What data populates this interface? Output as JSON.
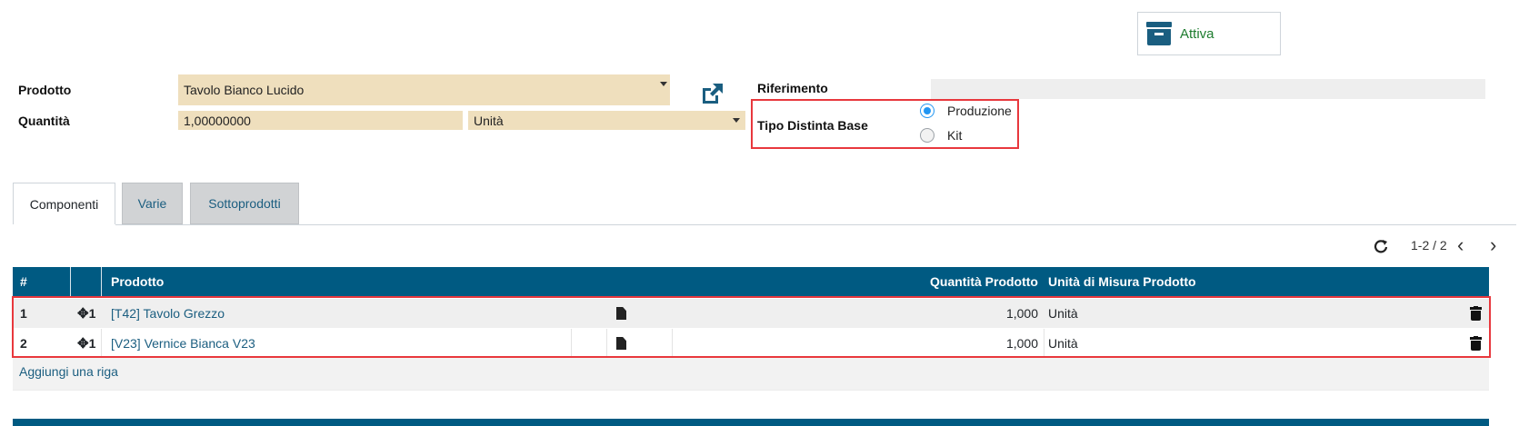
{
  "status": {
    "label": "Attiva",
    "icon": "archive-box-icon"
  },
  "form": {
    "product_label": "Prodotto",
    "product_value": "Tavolo Bianco Lucido",
    "quantity_label": "Quantità",
    "quantity_value": "1,00000000",
    "uom_value": "Unità",
    "reference_label": "Riferimento",
    "reference_value": "",
    "bom_type_label": "Tipo Distinta Base",
    "bom_type_options": [
      "Produzione",
      "Kit"
    ],
    "bom_type_selected": "Produzione"
  },
  "tabs": [
    {
      "label": "Componenti",
      "active": true
    },
    {
      "label": "Varie",
      "active": false
    },
    {
      "label": "Sottoprodotti",
      "active": false
    }
  ],
  "pager": {
    "text": "1-2 / 2"
  },
  "table": {
    "headers": {
      "index": "#",
      "product": "Prodotto",
      "quantity": "Quantità Prodotto",
      "uom": "Unità di Misura Prodotto"
    },
    "rows": [
      {
        "index": "1",
        "sequence": "1",
        "product": "[T42] Tavolo Grezzo",
        "quantity": "1,000",
        "uom": "Unità"
      },
      {
        "index": "2",
        "sequence": "1",
        "product": "[V23] Vernice Bianca V23",
        "quantity": "1,000",
        "uom": "Unità"
      }
    ],
    "add_line": "Aggiungi una riga"
  },
  "colors": {
    "header_bg": "#005a82",
    "highlight": "#e8383d",
    "input_bg": "#efdfbd",
    "link": "#1b5e80",
    "status_green": "#1d7c2e"
  }
}
